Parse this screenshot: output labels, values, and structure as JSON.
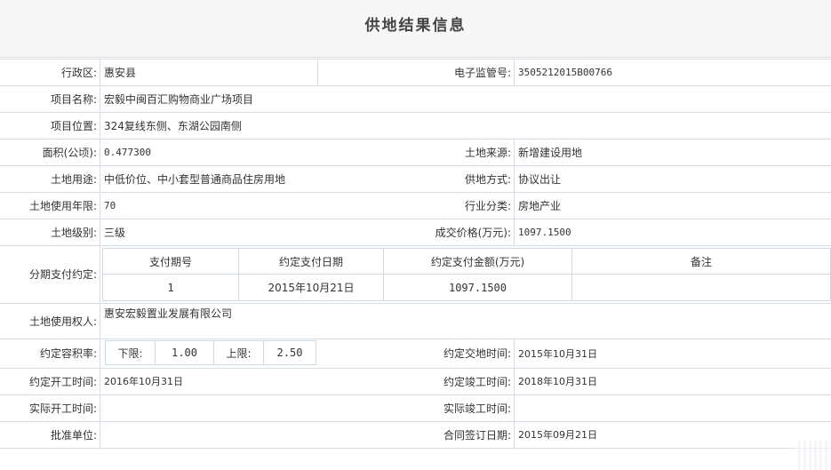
{
  "title": "供地结果信息",
  "rows": {
    "district_label": "行政区:",
    "district_value": "惠安县",
    "supervision_label": "电子监管号:",
    "supervision_value": "3505212015B00766",
    "project_name_label": "项目名称:",
    "project_name_value": "宏毅中闽百汇购物商业广场项目",
    "project_location_label": "项目位置:",
    "project_location_value": "324复线东侧、东湖公园南侧",
    "area_label": "面积(公顷):",
    "area_value": "0.477300",
    "land_source_label": "土地来源:",
    "land_source_value": "新增建设用地",
    "land_use_label": "土地用途:",
    "land_use_value": "中低价位、中小套型普通商品住房用地",
    "supply_method_label": "供地方式:",
    "supply_method_value": "协议出让",
    "use_years_label": "土地使用年限:",
    "use_years_value": "70",
    "industry_label": "行业分类:",
    "industry_value": "房地产业",
    "land_grade_label": "土地级别:",
    "land_grade_value": "三级",
    "price_label": "成交价格(万元):",
    "price_value": "1097.1500",
    "installment_label": "分期支付约定:",
    "installment_table": {
      "headers": [
        "支付期号",
        "约定支付日期",
        "约定支付金额(万元)",
        "备注"
      ],
      "rows": [
        [
          "1",
          "2015年10月21日",
          "1097.1500",
          ""
        ]
      ]
    },
    "owner_label": "土地使用权人:",
    "owner_value": "惠安宏毅置业发展有限公司",
    "far_label": "约定容积率:",
    "far": {
      "lower_label": "下限:",
      "lower_value": "1.00",
      "upper_label": "上限:",
      "upper_value": "2.50"
    },
    "delivery_label": "约定交地时间:",
    "delivery_value": "2015年10月31日",
    "start_label": "约定开工时间:",
    "start_value": "2016年10月31日",
    "finish_label": "约定竣工时间:",
    "finish_value": "2018年10月31日",
    "actual_start_label": "实际开工时间:",
    "actual_start_value": "",
    "actual_finish_label": "实际竣工时间:",
    "actual_finish_value": "",
    "approval_label": "批准单位:",
    "approval_value": "",
    "contract_date_label": "合同签订日期:",
    "contract_date_value": "2015年09月21日"
  }
}
